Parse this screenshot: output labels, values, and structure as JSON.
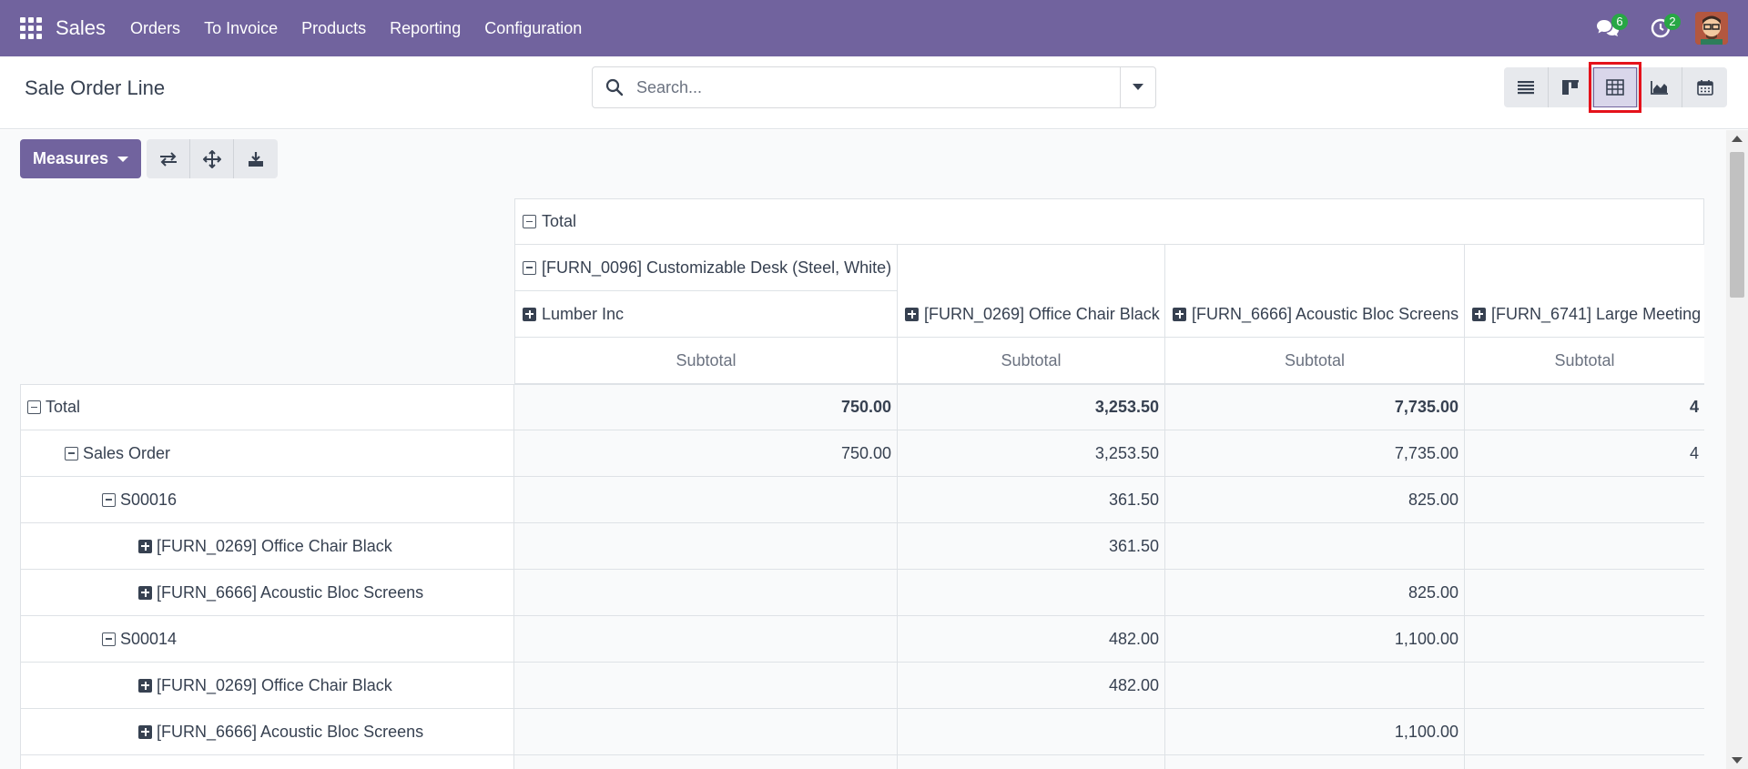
{
  "navbar": {
    "brand": "Sales",
    "menu": [
      "Orders",
      "To Invoice",
      "Products",
      "Reporting",
      "Configuration"
    ],
    "messages_badge": "6",
    "activities_badge": "2"
  },
  "control_panel": {
    "title": "Sale Order Line",
    "search_placeholder": "Search...",
    "views": [
      "list-view-icon",
      "kanban-view-icon",
      "pivot-view-icon",
      "graph-view-icon",
      "calendar-view-icon"
    ],
    "active_view": "pivot"
  },
  "toolbar": {
    "measures_label": "Measures"
  },
  "pivot": {
    "col_headers": {
      "total": "Total",
      "level1": "[FURN_0096] Customizable Desk (Steel, White)",
      "level2": [
        "Lumber Inc",
        "[FURN_0269] Office Chair Black",
        "[FURN_6666] Acoustic Bloc Screens",
        "[FURN_6741] Large Meeting"
      ],
      "measure": "Subtotal"
    },
    "rows": [
      {
        "label": "Total",
        "values": [
          "750.00",
          "3,253.50",
          "7,735.00",
          "4"
        ]
      },
      {
        "label": "Sales Order",
        "values": [
          "750.00",
          "3,253.50",
          "7,735.00",
          "4"
        ]
      },
      {
        "label": "S00016",
        "values": [
          "",
          "361.50",
          "825.00",
          ""
        ]
      },
      {
        "label": "[FURN_0269] Office Chair Black",
        "values": [
          "",
          "361.50",
          "",
          ""
        ]
      },
      {
        "label": "[FURN_6666] Acoustic Bloc Screens",
        "values": [
          "",
          "",
          "825.00",
          ""
        ]
      },
      {
        "label": "S00014",
        "values": [
          "",
          "482.00",
          "1,100.00",
          ""
        ]
      },
      {
        "label": "[FURN_0269] Office Chair Black",
        "values": [
          "",
          "482.00",
          "",
          ""
        ]
      },
      {
        "label": "[FURN_6666] Acoustic Bloc Screens",
        "values": [
          "",
          "",
          "1,100.00",
          ""
        ]
      }
    ]
  },
  "colors": {
    "brand": "#71639e",
    "highlight": "#e5121b",
    "badge": "#28a745"
  }
}
